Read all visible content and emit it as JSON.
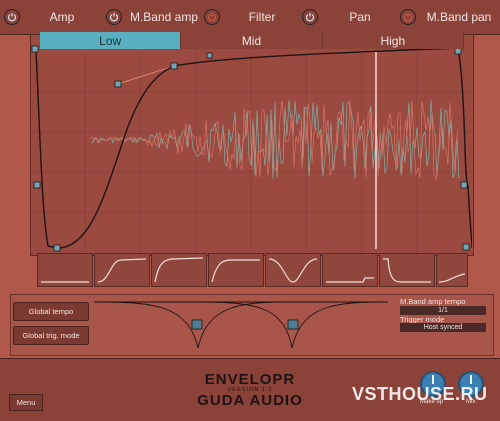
{
  "modules": [
    {
      "id": "amp",
      "label": "Amp",
      "enabled": true,
      "active": false
    },
    {
      "id": "mband-amp",
      "label": "M.Band amp",
      "enabled": true,
      "active": true
    },
    {
      "id": "filter",
      "label": "Filter",
      "enabled": false,
      "active": false
    },
    {
      "id": "pan",
      "label": "Pan",
      "enabled": true,
      "active": false
    },
    {
      "id": "mband-pan",
      "label": "M.Band pan",
      "enabled": false,
      "active": false
    }
  ],
  "bands": [
    {
      "label": "Low",
      "active": true
    },
    {
      "label": "Mid",
      "active": false
    },
    {
      "label": "High",
      "active": false
    }
  ],
  "presets": [
    "flat",
    "slow-rise",
    "fast-rise",
    "rise-hold",
    "dip",
    "step-up",
    "step-down",
    "late-rise"
  ],
  "buttons": {
    "global_tempo": "Global tempo",
    "global_trig_mode": "Global trig. mode",
    "menu": "Menu"
  },
  "info": {
    "tempo_label": "M.Band amp tempo",
    "tempo_value": "1/1",
    "trigger_label": "Trigger mode",
    "trigger_value": "Host synced"
  },
  "brand": {
    "name": "ENVELOPR",
    "version": "VERSION 1.2",
    "company": "GUDA AUDIO"
  },
  "knobs": [
    {
      "id": "makeup",
      "label": "Make up"
    },
    {
      "id": "mix",
      "label": "Mix"
    }
  ],
  "watermark": "VSTHOUSE.RU",
  "colors": {
    "accent": "#5ab0c0",
    "background": "#b1584a",
    "panel": "#8b4238",
    "waveform_red": "#e0776a",
    "waveform_teal": "#7fb9b0",
    "knob": "#3b7fb2"
  }
}
